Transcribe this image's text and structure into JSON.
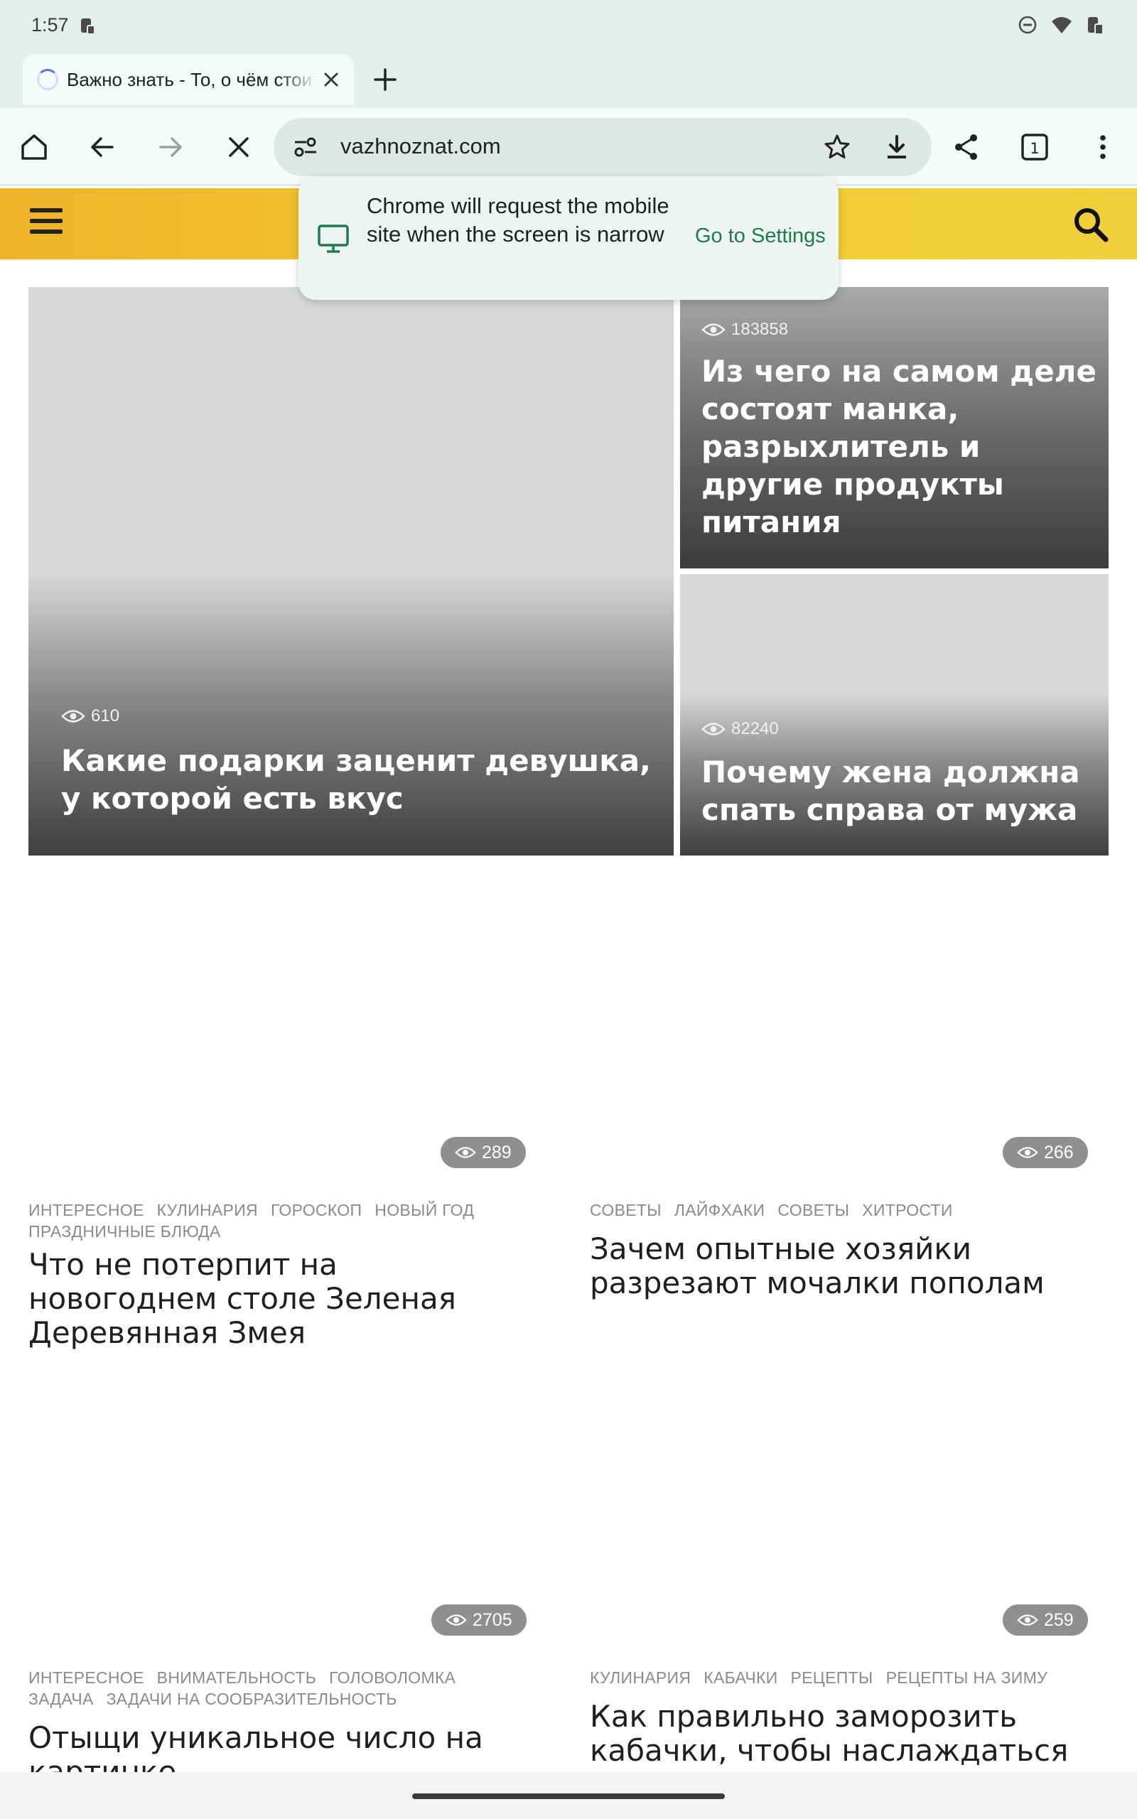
{
  "status_bar": {
    "time": "1:57"
  },
  "browser": {
    "tab_title": "Важно знать - То, о чём стоит знать",
    "url": "vazhnoznat.com"
  },
  "bubble": {
    "text": "Chrome will request the mobile site when the screen is narrow",
    "link": "Go to Settings"
  },
  "hero": [
    {
      "views": "610",
      "title": "Какие подарки заценит девушка, у которой есть вкус"
    },
    {
      "views": "183858",
      "title": "Из чего на самом деле состоят манка, разрыхлитель и другие продукты питания"
    },
    {
      "views": "82240",
      "title": "Почему жена должна спать справа от мужа"
    }
  ],
  "articles": [
    {
      "views": "289",
      "tags": [
        "ИНТЕРЕСНОЕ",
        "КУЛИНАРИЯ",
        "ГОРОСКОП",
        "НОВЫЙ ГОД",
        "ПРАЗДНИЧНЫЕ БЛЮДА"
      ],
      "title": "Что не потерпит на новогоднем столе Зеленая Деревянная Змея"
    },
    {
      "views": "266",
      "tags": [
        "СОВЕТЫ",
        "ЛАЙФХАКИ",
        "СОВЕТЫ",
        "ХИТРОСТИ"
      ],
      "title": "Зачем опытные хозяйки разрезают мочалки пополам"
    },
    {
      "views": "2705",
      "tags": [
        "ИНТЕРЕСНОЕ",
        "ВНИМАТЕЛЬНОСТЬ",
        "ГОЛОВОЛОМКА",
        "ЗАДАЧА",
        "ЗАДАЧИ НА СООБРАЗИТЕЛЬНОСТЬ"
      ],
      "title": "Отыщи уникальное число на картинке"
    },
    {
      "views": "259",
      "tags": [
        "КУЛИНАРИЯ",
        "КАБАЧКИ",
        "РЕЦЕПТЫ",
        "РЕЦЕПТЫ НА ЗИМУ"
      ],
      "title": "Как правильно заморозить кабачки, чтобы наслаждаться ими всю зиму"
    }
  ]
}
